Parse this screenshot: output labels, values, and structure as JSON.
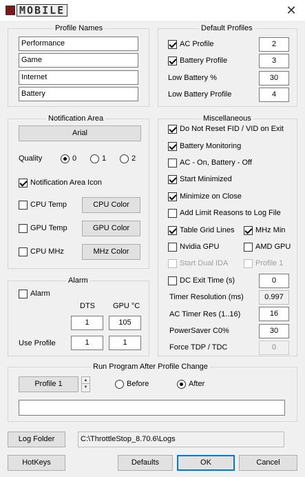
{
  "app": {
    "logo_text": "MOBILE"
  },
  "profile_names": {
    "title": "Profile Names",
    "values": [
      "Performance",
      "Game",
      "Internet",
      "Battery"
    ]
  },
  "default_profiles": {
    "title": "Default Profiles",
    "ac_profile_label": "AC Profile",
    "ac_profile_value": "2",
    "battery_profile_label": "Battery Profile",
    "battery_profile_value": "3",
    "low_battery_pct_label": "Low Battery %",
    "low_battery_pct_value": "30",
    "low_battery_profile_label": "Low Battery Profile",
    "low_battery_profile_value": "4"
  },
  "notification": {
    "title": "Notification Area",
    "font_button": "Arial",
    "quality_label": "Quality",
    "quality_options": [
      "0",
      "1",
      "2"
    ],
    "icon_label": "Notification Area Icon",
    "cpu_temp_label": "CPU Temp",
    "cpu_color_button": "CPU Color",
    "gpu_temp_label": "GPU Temp",
    "gpu_color_button": "GPU Color",
    "cpu_mhz_label": "CPU MHz",
    "mhz_color_button": "MHz Color"
  },
  "alarm": {
    "title": "Alarm",
    "alarm_label": "Alarm",
    "dts_label": "DTS",
    "gpu_label": "GPU °C",
    "dts_value": "1",
    "gpu_value": "105",
    "use_profile_label": "Use Profile",
    "use_profile_dts": "1",
    "use_profile_gpu": "1"
  },
  "misc": {
    "title": "Miscellaneous",
    "do_not_reset": "Do Not Reset FID / VID on Exit",
    "battery_monitoring": "Battery Monitoring",
    "ac_on_battery_off": "AC - On, Battery - Off",
    "start_minimized": "Start Minimized",
    "minimize_on_close": "Minimize on Close",
    "add_limit_reasons": "Add Limit Reasons to Log File",
    "table_grid_lines": "Table Grid Lines",
    "mhz_min": "MHz Min",
    "nvidia_gpu": "Nvidia GPU",
    "amd_gpu": "AMD GPU",
    "start_dual_ida": "Start Dual IDA",
    "profile_1": "Profile 1",
    "dc_exit_time_label": "DC Exit Time (s)",
    "dc_exit_time_value": "0",
    "timer_resolution_label": "Timer Resolution (ms)",
    "timer_resolution_value": "0.997",
    "ac_timer_res_label": "AC Timer Res (1..16)",
    "ac_timer_res_value": "16",
    "powersaver_label": "PowerSaver C0%",
    "powersaver_value": "30",
    "force_tdp_label": "Force TDP / TDC",
    "force_tdp_value": "0"
  },
  "run_program": {
    "title": "Run Program After Profile Change",
    "profile_button": "Profile 1",
    "before_label": "Before",
    "after_label": "After",
    "program_path": ""
  },
  "log": {
    "log_folder_button": "Log Folder",
    "log_path": "C:\\ThrottleStop_8.70.6\\Logs"
  },
  "footer": {
    "hotkeys": "HotKeys",
    "defaults": "Defaults",
    "ok": "OK",
    "cancel": "Cancel"
  },
  "colors": {
    "accent": "#0078d7",
    "logo_red": "#7a1a1a"
  }
}
